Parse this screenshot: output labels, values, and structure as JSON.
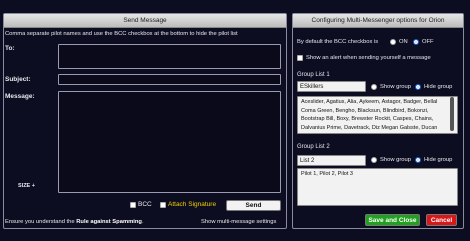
{
  "left": {
    "header": "Send Message",
    "instructions": "Comma separate pilot names and use the BCC checkbox at the bottom to hide the pilot list",
    "to_label": "To:",
    "to_value": "",
    "subject_label": "Subject:",
    "subject_value": "",
    "message_label": "Message:",
    "message_value": "",
    "size_label": "SIZE +",
    "bcc_label": "BCC",
    "attach_label": "Attach Signature",
    "send_label": "Send",
    "footer_text_pre": "Ensure you understand the ",
    "footer_rule": "Rule against Spamming",
    "footer_text_post": ".",
    "show_settings": "Show multi-message settings"
  },
  "right": {
    "header": "Configuring Multi-Messenger options for Orion",
    "bcc_default_label": "By default the BCC checkbox is",
    "on_label": "ON",
    "off_label": "OFF",
    "alert_label": "Show an alert when sending yourself a message",
    "group1": {
      "title": "Group List 1",
      "name": "ESkillers",
      "show_label": "Show group",
      "hide_label": "Hide group",
      "members": "Aceslider, Agatius, Alia, Aykeem, Astagor, Badger, Bellal Coma Green, Bengho, Blacksun, Blindbird, Bokonzi, Bootstrap Bill, Boxy, Brewster Rockit, Caspes, Chains, Dalvanius Prime, Davetrack, Diz Megan Galsste, Ducan Idaho, Eldritch, Endion, Firkin"
    },
    "group2": {
      "title": "Group List 2",
      "name": "List 2",
      "show_label": "Show group",
      "hide_label": "Hide group",
      "members": "Pilot 1, Pilot 2, Pilot 3"
    },
    "save_label": "Save and Close",
    "cancel_label": "Cancel"
  },
  "colors": {
    "background": "#0d0d21",
    "attach_text": "#f0d000",
    "save_button": "#22a020",
    "cancel_button": "#d81818",
    "radio_selected": "#1a5fd6"
  }
}
